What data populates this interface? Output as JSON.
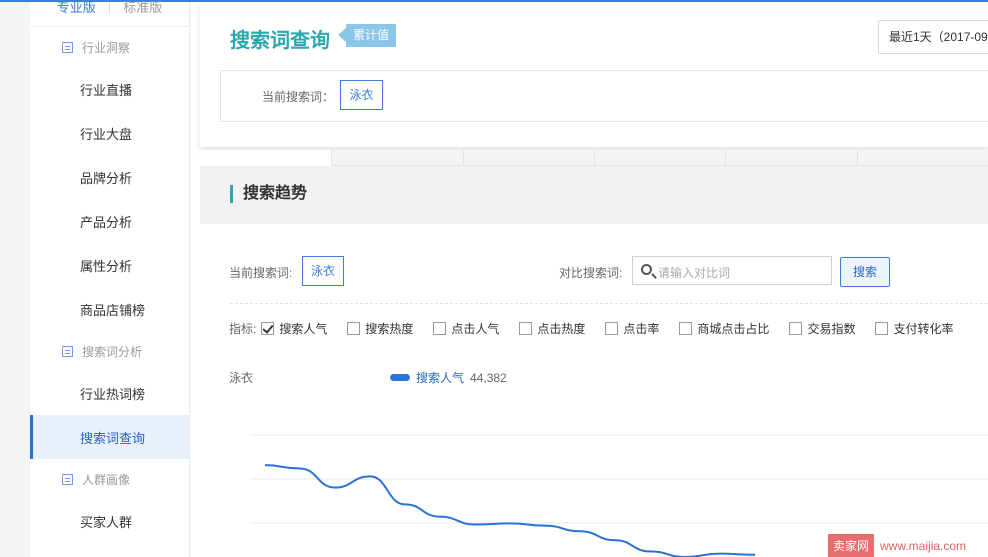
{
  "sidebar": {
    "version_tabs": {
      "pro": "专业版",
      "standard": "标准版"
    },
    "groups": [
      {
        "label": "行业洞察",
        "items": [
          "行业直播",
          "行业大盘",
          "品牌分析",
          "产品分析",
          "属性分析",
          "商品店铺榜"
        ]
      },
      {
        "label": "搜索词分析",
        "items": [
          "行业热词榜",
          "搜索词查询"
        ]
      },
      {
        "label": "人群画像",
        "items": [
          "买家人群"
        ]
      }
    ],
    "active_item": "搜索词查询"
  },
  "header": {
    "title": "搜索词查询",
    "tag": "累计值",
    "date_range": "最近1天（2017-09",
    "current_term_label": "当前搜索词：",
    "current_term": "泳衣"
  },
  "trend": {
    "title": "搜索趋势",
    "current_label": "当前搜索词:",
    "current_term": "泳衣",
    "compare_label": "对比搜索词:",
    "compare_placeholder": "请输入对比词",
    "search_button": "搜索",
    "metrics_label": "指标:",
    "metrics": [
      {
        "label": "搜索人气",
        "checked": true
      },
      {
        "label": "搜索热度",
        "checked": false
      },
      {
        "label": "点击人气",
        "checked": false
      },
      {
        "label": "点击热度",
        "checked": false
      },
      {
        "label": "点击率",
        "checked": false
      },
      {
        "label": "商城点击占比",
        "checked": false
      },
      {
        "label": "交易指数",
        "checked": false
      },
      {
        "label": "支付转化率",
        "checked": false
      }
    ],
    "series_term": "泳衣",
    "legend_name": "搜索人气",
    "legend_value": "44,382"
  },
  "chart_data": {
    "type": "line",
    "series": [
      {
        "name": "搜索人气",
        "values": [
          0.82,
          0.79,
          0.62,
          0.72,
          0.47,
          0.36,
          0.29,
          0.3,
          0.28,
          0.23,
          0.15,
          0.05,
          0.0,
          0.03,
          0.02
        ]
      }
    ],
    "grid": true,
    "color": "#2a72d5"
  },
  "watermark": {
    "logo": "卖家网",
    "url": "www.maijia.com"
  }
}
